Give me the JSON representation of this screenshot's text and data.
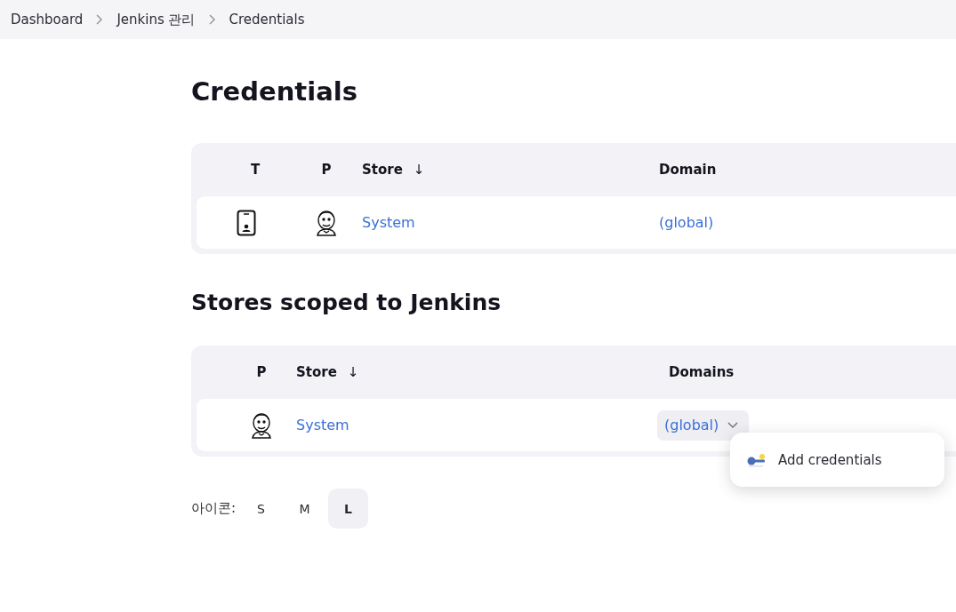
{
  "breadcrumbs": [
    {
      "label": "Dashboard"
    },
    {
      "label": "Jenkins 관리"
    },
    {
      "label": "Credentials"
    }
  ],
  "title": "Credentials",
  "credentials_table": {
    "columns": [
      {
        "label": "T"
      },
      {
        "label": "P"
      },
      {
        "label": "Store",
        "sort": "↓"
      },
      {
        "label": "Domain"
      }
    ],
    "rows": [
      {
        "store": "System",
        "domain": "(global)"
      }
    ]
  },
  "section_title": "Stores scoped to Jenkins",
  "stores_table": {
    "columns": [
      {
        "label": "P"
      },
      {
        "label": "Store",
        "sort": "↓"
      },
      {
        "label": "Domains"
      }
    ],
    "rows": [
      {
        "store": "System",
        "domain": "(global)",
        "expanded": true
      }
    ]
  },
  "dropdown_menu": {
    "items": [
      {
        "label": "Add credentials"
      }
    ]
  },
  "icon_size": {
    "label": "아이콘:",
    "options": [
      {
        "label": "S",
        "selected": false
      },
      {
        "label": "M",
        "selected": false
      },
      {
        "label": "L",
        "selected": true
      }
    ]
  }
}
